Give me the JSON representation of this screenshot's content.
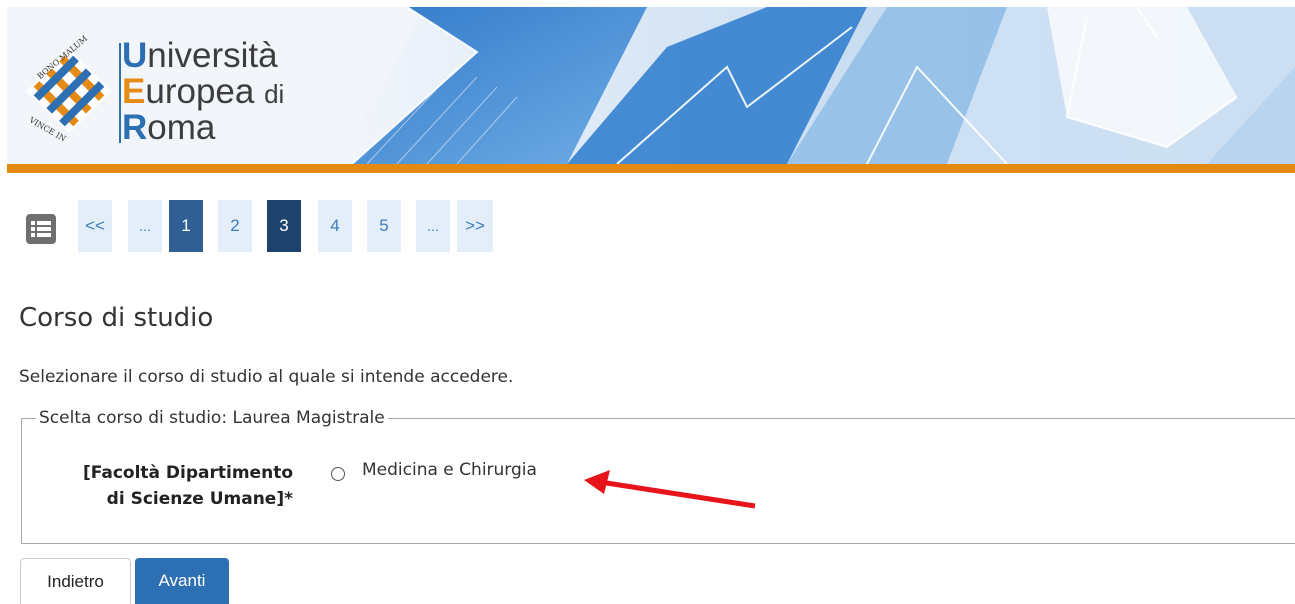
{
  "header": {
    "logo_line1_cap": "U",
    "logo_line1_rest": "niversità",
    "logo_line2_cap": "E",
    "logo_line2_rest": "uropea",
    "logo_line2_small": "di",
    "logo_line3_cap": "R",
    "logo_line3_rest": "oma",
    "logo_seal_text": "VINCE IN BONO MALUM",
    "brand_blue": "#2c6fb3",
    "brand_orange": "#e48a12"
  },
  "pager": {
    "menu_icon": "list-icon",
    "first_label": "<<",
    "ellipsis_left": "...",
    "pages": [
      "1",
      "2",
      "3",
      "4",
      "5"
    ],
    "ellipsis_right": "...",
    "last_label": ">>",
    "current_page": "3"
  },
  "content": {
    "title": "Corso di studio",
    "intro": "Selezionare il corso di studio al quale si intende accedere.",
    "fieldset_legend": "Scelta corso di studio: Laurea Magistrale",
    "field_label_line1": "[Facoltà Dipartimento",
    "field_label_line2": "di Scienze Umane]*",
    "option_label": "Medicina e Chirurgia",
    "annotation_arrow_color": "#e8141b"
  },
  "buttons": {
    "back": "Indietro",
    "next": "Avanti"
  }
}
